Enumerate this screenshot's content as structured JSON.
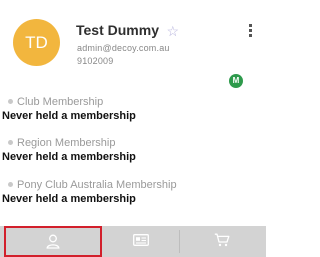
{
  "profile": {
    "initials": "TD",
    "name": "Test Dummy",
    "email": "admin@decoy.com.au",
    "member_id": "9102009",
    "badge": "M"
  },
  "memberships": [
    {
      "label": "Club Membership",
      "value": "Never held a membership"
    },
    {
      "label": "Region Membership",
      "value": "Never held a membership"
    },
    {
      "label": "Pony Club Australia Membership",
      "value": "Never held a membership"
    }
  ],
  "tabs": [
    {
      "icon": "user-icon",
      "active": true
    },
    {
      "icon": "id-card-icon",
      "active": false
    },
    {
      "icon": "cart-icon",
      "active": false
    }
  ],
  "colors": {
    "avatar": "#f2b63e",
    "badge": "#2e9a4c",
    "active_tab_border": "#d21f2b",
    "footer_bg": "#d3d3d3",
    "star": "#b5b2dc"
  }
}
